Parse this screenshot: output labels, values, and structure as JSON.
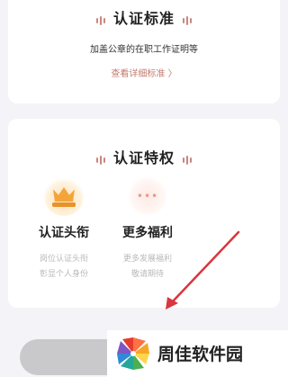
{
  "standard": {
    "title": "认证标准",
    "description": "加盖公章的在职工作证明等",
    "link_text": "查看详细标准 〉"
  },
  "privilege": {
    "title": "认证特权",
    "items": [
      {
        "icon": "crown-icon",
        "name": "认证头衔",
        "line1": "岗位认证头衔",
        "line2": "彰显个人身份"
      },
      {
        "icon": "more-icon",
        "name": "更多福利",
        "line1": "更多发展福利",
        "line2": "敬请期待"
      }
    ]
  },
  "watermark": {
    "text": "周佳软件园"
  },
  "colors": {
    "accent": "#c47a6e",
    "arrow": "#d9363e",
    "button": "#c9c9cb"
  }
}
